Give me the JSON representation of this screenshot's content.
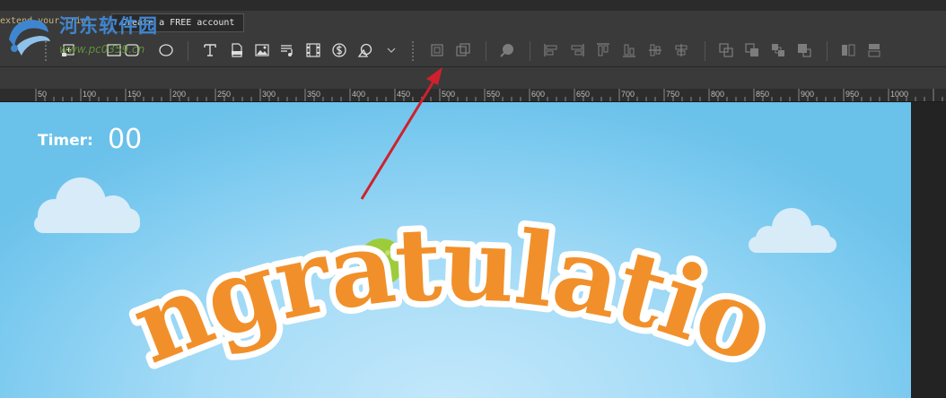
{
  "trial": {
    "notice": "extend your trial",
    "create_account": "Create a FREE account"
  },
  "watermark": {
    "title": "河东软件园",
    "url": "www.pc0359.cn"
  },
  "toolbar": {
    "groups": [
      [
        "add-symbol-icon",
        "rectangle-icon",
        "ellipse-icon"
      ],
      [
        "text-icon",
        "html-widget-icon",
        "image-icon",
        "audio-icon",
        "video-icon",
        "cost-icon",
        "shape-icon",
        "more-dropdown-icon"
      ],
      [
        "group-icon",
        "ungroup-icon"
      ],
      [
        "color-picker-icon"
      ],
      [
        "align-left-icon",
        "align-right-icon",
        "align-top-icon",
        "align-bottom-icon",
        "align-center-v-icon",
        "align-center-h-icon"
      ],
      [
        "bring-forward-icon",
        "send-backward-icon",
        "bring-front-icon",
        "send-back-icon"
      ],
      [
        "distribute-h-icon",
        "distribute-v-icon"
      ]
    ]
  },
  "ruler": {
    "labels": [
      "50",
      "100",
      "150",
      "200",
      "250",
      "300",
      "350",
      "400",
      "450",
      "500",
      "550",
      "600",
      "650",
      "700",
      "750",
      "800",
      "850",
      "900",
      "950",
      "1000"
    ]
  },
  "stage": {
    "timer_label": "Timer:",
    "timer_value": "00",
    "headline": "congratulations"
  },
  "colors": {
    "headline_fill": "#f1902a",
    "headline_stroke": "#ffffff",
    "sky_center": "#c4e8fb",
    "sky_edge": "#6ac1ea",
    "annotation_arrow": "#d0202c"
  }
}
